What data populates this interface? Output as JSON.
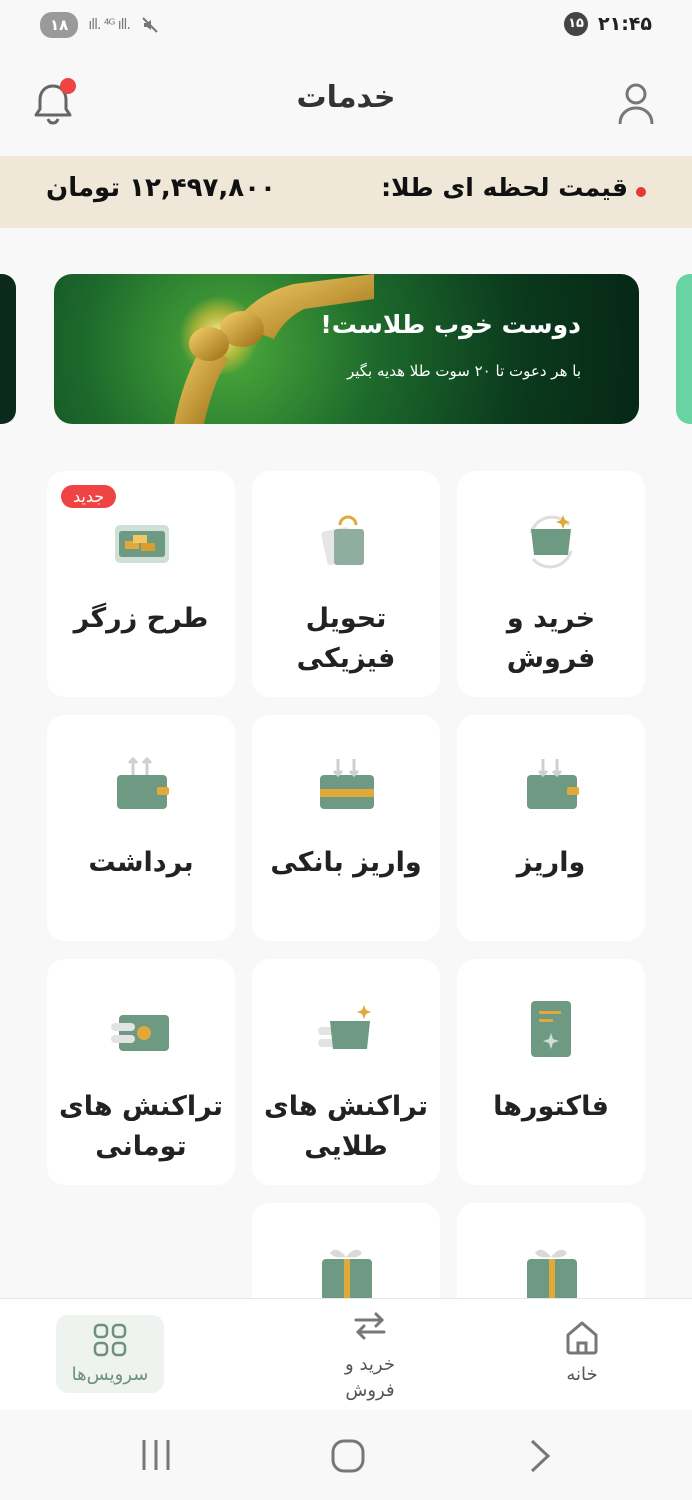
{
  "status_bar": {
    "left_badge": "۱۸",
    "signal_text": "ıll. ⁴ᴳ ıll.",
    "right_circle": "۱۵",
    "time": "۲۱:۴۵"
  },
  "header": {
    "title": "خدمات",
    "bell_icon": "bell-icon",
    "user_icon": "user-icon"
  },
  "gold_price": {
    "label": "قیمت لحظه ای طلا:",
    "value": "۱۲,۴۹۷,۸۰۰ تومان",
    "dot_color": "#e53935"
  },
  "banner": {
    "title": "دوست خوب طلاست!",
    "subtitle": "با هر دعوت تا ۲۰ سوت طلا هدیه بگیر"
  },
  "services": [
    {
      "label": "خرید و فروش",
      "icon": "wallet-cycle-icon"
    },
    {
      "label": "تحویل فیزیکی",
      "icon": "shopping-bag-icon"
    },
    {
      "label": "طرح زرگر",
      "icon": "gold-card-icon",
      "badge": "جدید"
    },
    {
      "label": "واریز",
      "icon": "wallet-deposit-icon"
    },
    {
      "label": "واریز بانکی",
      "icon": "card-deposit-icon"
    },
    {
      "label": "برداشت",
      "icon": "wallet-withdraw-icon"
    },
    {
      "label": "فاکتورها",
      "icon": "invoice-icon"
    },
    {
      "label": "تراکنش های طلایی",
      "icon": "gold-transactions-icon"
    },
    {
      "label": "تراکنش های تومانی",
      "icon": "toman-transactions-icon"
    },
    {
      "label": "",
      "icon": "gift-icon"
    },
    {
      "label": "",
      "icon": "gift-icon"
    }
  ],
  "bottom_nav": {
    "home": "خانه",
    "trade": "خرید و فروش",
    "services": "سرویس‌ها"
  },
  "colors": {
    "accent_green": "#6e9a84",
    "gold": "#e0a93a",
    "price_bar_bg": "#efe7d8",
    "badge_red": "#ef4444"
  }
}
